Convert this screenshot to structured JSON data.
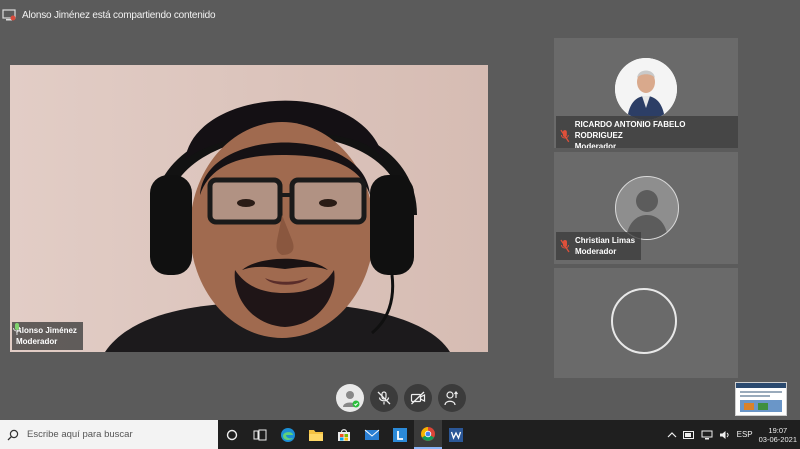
{
  "sharing_banner": "Alonso Jiménez está compartiendo contenido",
  "main_participant": {
    "name": "Alonso Jiménez",
    "role": "Moderador"
  },
  "participants": [
    {
      "name": "RICARDO ANTONIO FABELO RODRIGUEZ",
      "role": "Moderador"
    },
    {
      "name": "Christian Limas",
      "role": "Moderador"
    },
    {
      "name": "",
      "role": ""
    }
  ],
  "taskbar": {
    "search_placeholder": "Escribe aquí para buscar",
    "language": "ESP",
    "time": "19:07",
    "date": "03-06-2021"
  },
  "colors": {
    "background": "#5b5b5b",
    "tile": "#6a6a6a",
    "taskbar": "#1f1f1f",
    "muted_red": "#e0503a",
    "ok_green": "#2bbf3c"
  }
}
